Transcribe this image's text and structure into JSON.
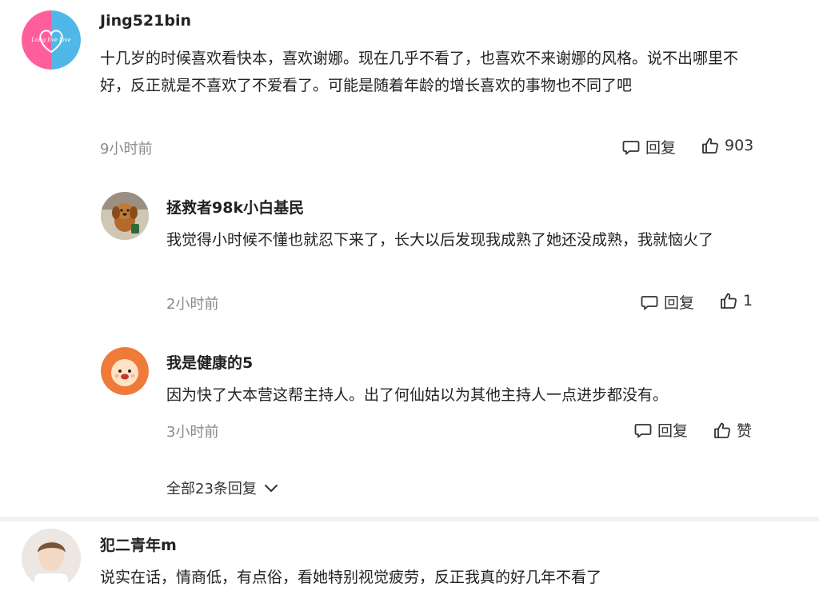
{
  "comments": [
    {
      "username": "Jing521bin",
      "text": "十几岁的时候喜欢看快本，喜欢谢娜。现在几乎不看了，也喜欢不来谢娜的风格。说不出哪里不好，反正就是不喜欢了不爱看了。可能是随着年龄的增长喜欢的事物也不同了吧",
      "time": "9小时前",
      "reply_label": "回复",
      "likes": "903",
      "avatar_text": "Long live love"
    },
    {
      "username": "拯救者98k小白基民",
      "text": "我觉得小时候不懂也就忍下来了，长大以后发现我成熟了她还没成熟，我就恼火了",
      "time": "2小时前",
      "reply_label": "回复",
      "likes": "1"
    },
    {
      "username": "我是健康的5",
      "text": "因为快了大本营这帮主持人。出了何仙姑以为其他主持人一点进步都没有。",
      "time": "3小时前",
      "reply_label": "回复",
      "likes": "赞"
    },
    {
      "username": "犯二青年m",
      "text": "说实在话，情商低，有点俗，看她特别视觉疲劳，反正我真的好几年不看了"
    }
  ],
  "view_all_replies": "全部23条回复",
  "icons": {
    "reply": "comment-bubble-icon",
    "like": "thumbs-up-icon",
    "expand": "chevron-down-icon"
  },
  "colors": {
    "avatar1_left": "#ff5e9c",
    "avatar1_right": "#4fb8e8",
    "avatar3_bg": "#ef7a3a"
  }
}
